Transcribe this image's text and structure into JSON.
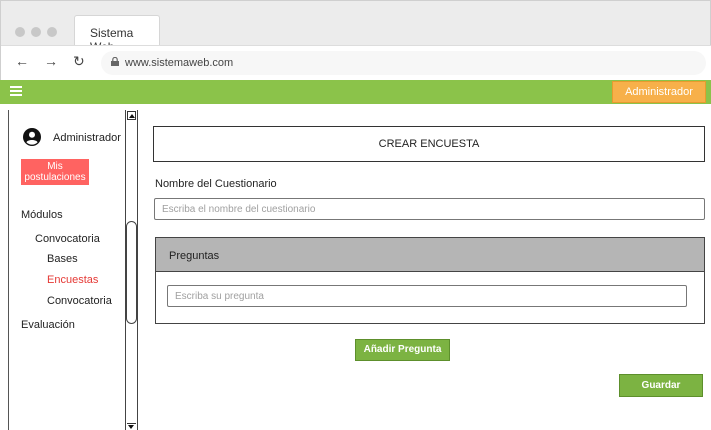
{
  "browser": {
    "tab_title": "Sistema Web",
    "url": "www.sistemaweb.com"
  },
  "appbar": {
    "admin_button": "Administrador"
  },
  "sidebar": {
    "user_name": "Administrador",
    "mis_postulaciones": "Mis postulaciones",
    "modulos": "Módulos",
    "convocatoria": "Convocatoria",
    "bases": "Bases",
    "encuestas": "Encuestas",
    "convocatoria_sub": "Convocatoria",
    "evaluacion": "Evaluación"
  },
  "main": {
    "crear_title": "CREAR ENCUESTA",
    "nombre_label": "Nombre del Cuestionario",
    "nombre_placeholder": "Escriba el nombre del cuestionario",
    "preguntas_header": "Preguntas",
    "pregunta_placeholder": "Escriba su pregunta",
    "add_button": "Añadir Pregunta",
    "save_button": "Guardar"
  }
}
